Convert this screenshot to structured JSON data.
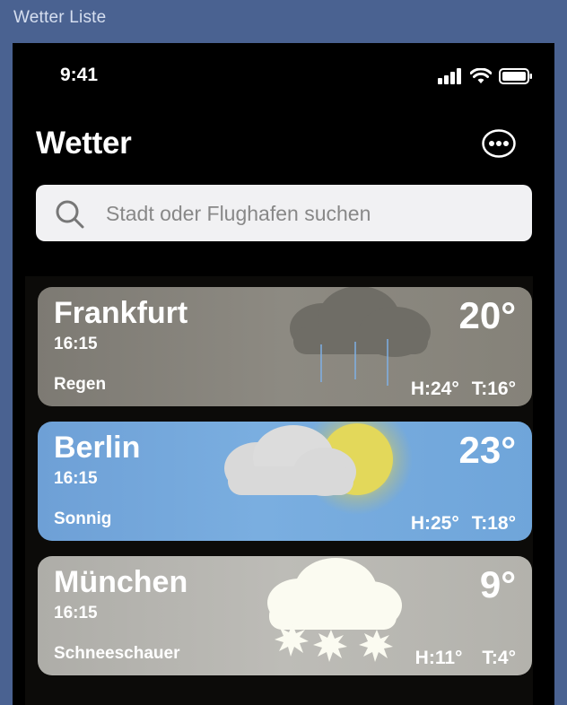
{
  "window": {
    "title": "Wetter Liste"
  },
  "status_bar": {
    "time": "9:41"
  },
  "header": {
    "title": "Wetter"
  },
  "search": {
    "placeholder": "Stadt oder Flughafen suchen"
  },
  "cities": [
    {
      "name": "Frankfurt",
      "time": "16:15",
      "condition": "Regen",
      "temp": "20°",
      "high": "H:24°",
      "low": "T:16°",
      "icon": "rain-cloud-icon",
      "bg": "#85827a"
    },
    {
      "name": "Berlin",
      "time": "16:15",
      "condition": "Sonnig",
      "temp": "23°",
      "high": "H:25°",
      "low": "T:18°",
      "icon": "sun-cloud-icon",
      "bg": "#6fa4d8"
    },
    {
      "name": "München",
      "time": "16:15",
      "condition": "Schneeschauer",
      "temp": "9°",
      "high": "H:11°",
      "low": "T:4°",
      "icon": "snow-cloud-icon",
      "bg": "#b5b4b0"
    }
  ]
}
